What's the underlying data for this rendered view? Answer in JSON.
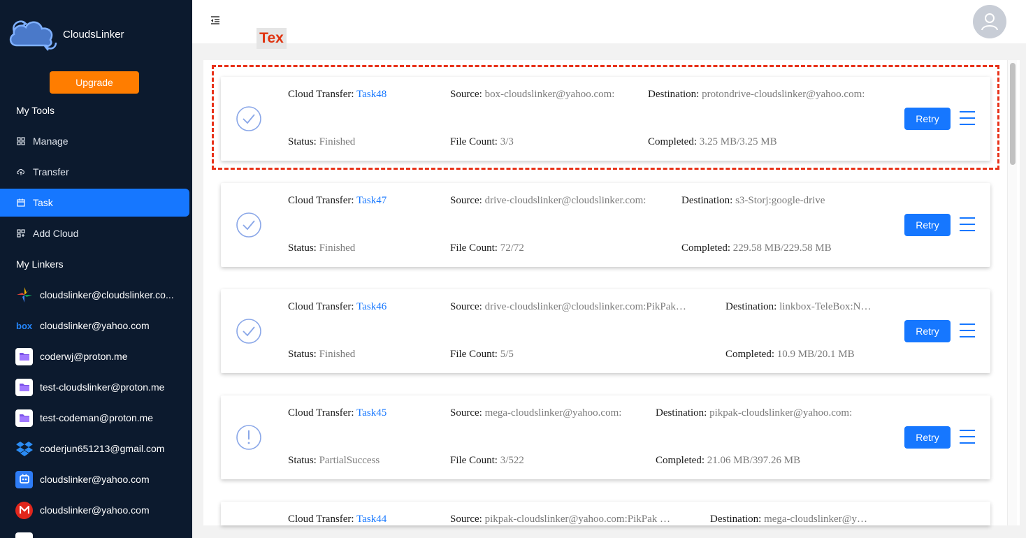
{
  "app": {
    "brand": "CloudsLinker",
    "upgrade_label": "Upgrade"
  },
  "sidebar": {
    "tools_title": "My Tools",
    "items": [
      {
        "label": "Manage",
        "icon": "grid-icon",
        "active": false
      },
      {
        "label": "Transfer",
        "icon": "cloud-upload-icon",
        "active": false
      },
      {
        "label": "Task",
        "icon": "calendar-icon",
        "active": true
      },
      {
        "label": "Add Cloud",
        "icon": "grid-plus-icon",
        "active": false
      }
    ],
    "linkers_title": "My Linkers",
    "linkers": [
      {
        "label": "cloudslinker@cloudslinker.co...",
        "icon": "google-drive-icon"
      },
      {
        "label": "cloudslinker@yahoo.com",
        "icon": "box-icon"
      },
      {
        "label": "coderwj@proton.me",
        "icon": "proton-drive-icon"
      },
      {
        "label": "test-cloudslinker@proton.me",
        "icon": "proton-drive-icon"
      },
      {
        "label": "test-codeman@proton.me",
        "icon": "proton-drive-icon"
      },
      {
        "label": "coderjun651213@gmail.com",
        "icon": "dropbox-icon"
      },
      {
        "label": "cloudslinker@yahoo.com",
        "icon": "pikpak-icon"
      },
      {
        "label": "cloudslinker@yahoo.com",
        "icon": "mega-icon"
      }
    ]
  },
  "header": {
    "tex_label": "Tex"
  },
  "labels": {
    "cloud_transfer": "Cloud Transfer:",
    "source": "Source:",
    "destination": "Destination:",
    "status": "Status:",
    "file_count": "File Count:",
    "completed": "Completed:",
    "retry": "Retry"
  },
  "tasks": [
    {
      "name": "Task48",
      "source": "box-cloudslinker@yahoo.com:",
      "destination": "protondrive-cloudslinker@yahoo.com:",
      "status": "Finished",
      "file_count": "3/3",
      "completed": "3.25 MB/3.25 MB",
      "icon": "check-circle-icon"
    },
    {
      "name": "Task47",
      "source": "drive-cloudslinker@cloudslinker.com:",
      "destination": "s3-Storj:google-drive",
      "status": "Finished",
      "file_count": "72/72",
      "completed": "229.58 MB/229.58 MB",
      "icon": "check-circle-icon"
    },
    {
      "name": "Task46",
      "source": "drive-cloudslinker@cloudslinker.com:PikPak…",
      "destination": "linkbox-TeleBox:N…",
      "status": "Finished",
      "file_count": "5/5",
      "completed": "10.9 MB/20.1 MB",
      "icon": "check-circle-icon"
    },
    {
      "name": "Task45",
      "source": "mega-cloudslinker@yahoo.com:",
      "destination": "pikpak-cloudslinker@yahoo.com:",
      "status": "PartialSuccess",
      "file_count": "3/522",
      "completed": "21.06 MB/397.26 MB",
      "icon": "exclamation-circle-icon"
    },
    {
      "name": "Task44",
      "source": "pikpak-cloudslinker@yahoo.com:PikPak …",
      "destination": "mega-cloudslinker@y…",
      "status": "",
      "file_count": "",
      "completed": "",
      "icon": "check-circle-icon"
    }
  ]
}
